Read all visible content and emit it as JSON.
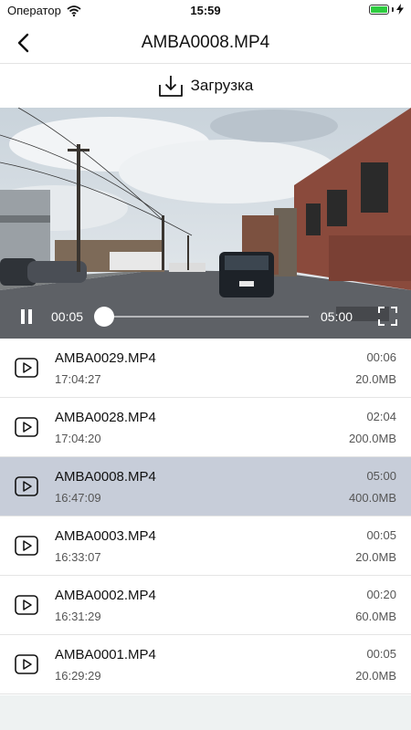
{
  "status_bar": {
    "carrier": "Оператор",
    "time": "15:59"
  },
  "nav": {
    "title": "AMBA0008.MP4"
  },
  "download": {
    "label": "Загрузка"
  },
  "player": {
    "current_time": "00:05",
    "total_time": "05:00",
    "progress": 0.017,
    "state": "playing"
  },
  "files": [
    {
      "name": "AMBA0029.MP4",
      "time": "17:04:27",
      "duration": "00:06",
      "size": "20.0MB",
      "selected": false
    },
    {
      "name": "AMBA0028.MP4",
      "time": "17:04:20",
      "duration": "02:04",
      "size": "200.0MB",
      "selected": false
    },
    {
      "name": "AMBA0008.MP4",
      "time": "16:47:09",
      "duration": "05:00",
      "size": "400.0MB",
      "selected": true
    },
    {
      "name": "AMBA0003.MP4",
      "time": "16:33:07",
      "duration": "00:05",
      "size": "20.0MB",
      "selected": false
    },
    {
      "name": "AMBA0002.MP4",
      "time": "16:31:29",
      "duration": "00:20",
      "size": "60.0MB",
      "selected": false
    },
    {
      "name": "AMBA0001.MP4",
      "time": "16:29:29",
      "duration": "00:05",
      "size": "20.0MB",
      "selected": false
    }
  ],
  "colors": {
    "selected_row": "#c7cdd9",
    "battery": "#2ecc40"
  },
  "icons": {
    "back": "chevron-left-icon",
    "download": "download-icon",
    "pause": "pause-icon",
    "fullscreen": "fullscreen-icon",
    "file_play": "play-icon",
    "wifi": "wifi-icon",
    "battery": "battery-icon"
  }
}
